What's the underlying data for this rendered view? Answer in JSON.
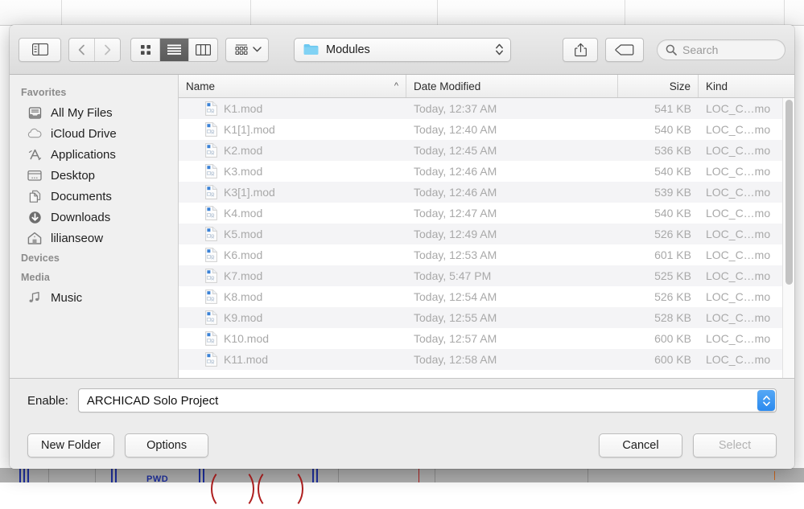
{
  "toolbar": {
    "sidebar_toggle": "sidebar-toggle",
    "back": "back",
    "forward": "forward",
    "view_icon": "icon-view",
    "view_list": "list-view",
    "view_column": "column-view",
    "arrange": "arrange",
    "path_label": "Modules",
    "share": "share",
    "tag": "tag",
    "search_placeholder": "Search",
    "search_value": ""
  },
  "sidebar": {
    "sections": [
      {
        "title": "Favorites",
        "items": [
          {
            "label": "All My Files",
            "icon": "all-my-files-icon"
          },
          {
            "label": "iCloud Drive",
            "icon": "icloud-drive-icon"
          },
          {
            "label": "Applications",
            "icon": "applications-icon"
          },
          {
            "label": "Desktop",
            "icon": "desktop-icon"
          },
          {
            "label": "Documents",
            "icon": "documents-icon"
          },
          {
            "label": "Downloads",
            "icon": "downloads-icon"
          },
          {
            "label": "lilianseow",
            "icon": "home-icon"
          }
        ]
      },
      {
        "title": "Devices",
        "items": []
      },
      {
        "title": "Media",
        "items": [
          {
            "label": "Music",
            "icon": "music-icon"
          }
        ]
      }
    ]
  },
  "filelist": {
    "columns": [
      {
        "key": "name",
        "label": "Name",
        "sort": "ascending"
      },
      {
        "key": "date",
        "label": "Date Modified"
      },
      {
        "key": "size",
        "label": "Size"
      },
      {
        "key": "kind",
        "label": "Kind"
      }
    ],
    "rows": [
      {
        "name": "K1.mod",
        "date": "Today, 12:37 AM",
        "size": "541 KB",
        "kind": "LOC_C…mo"
      },
      {
        "name": "K1[1].mod",
        "date": "Today, 12:40 AM",
        "size": "540 KB",
        "kind": "LOC_C…mo"
      },
      {
        "name": "K2.mod",
        "date": "Today, 12:45 AM",
        "size": "536 KB",
        "kind": "LOC_C…mo"
      },
      {
        "name": "K3.mod",
        "date": "Today, 12:46 AM",
        "size": "540 KB",
        "kind": "LOC_C…mo"
      },
      {
        "name": "K3[1].mod",
        "date": "Today, 12:46 AM",
        "size": "539 KB",
        "kind": "LOC_C…mo"
      },
      {
        "name": "K4.mod",
        "date": "Today, 12:47 AM",
        "size": "540 KB",
        "kind": "LOC_C…mo"
      },
      {
        "name": "K5.mod",
        "date": "Today, 12:49 AM",
        "size": "526 KB",
        "kind": "LOC_C…mo"
      },
      {
        "name": "K6.mod",
        "date": "Today, 12:53 AM",
        "size": "601 KB",
        "kind": "LOC_C…mo"
      },
      {
        "name": "K7.mod",
        "date": "Today, 5:47 PM",
        "size": "525 KB",
        "kind": "LOC_C…mo"
      },
      {
        "name": "K8.mod",
        "date": "Today, 12:54 AM",
        "size": "526 KB",
        "kind": "LOC_C…mo"
      },
      {
        "name": "K9.mod",
        "date": "Today, 12:55 AM",
        "size": "528 KB",
        "kind": "LOC_C…mo"
      },
      {
        "name": "K10.mod",
        "date": "Today, 12:57 AM",
        "size": "600 KB",
        "kind": "LOC_C…mo"
      },
      {
        "name": "K11.mod",
        "date": "Today, 12:58 AM",
        "size": "600 KB",
        "kind": "LOC_C…mo"
      }
    ]
  },
  "enable": {
    "label": "Enable:",
    "value": "ARCHICAD Solo Project"
  },
  "buttons": {
    "new_folder": "New Folder",
    "options": "Options",
    "cancel": "Cancel",
    "select": "Select"
  },
  "background": {
    "cad_label": "PWD"
  },
  "colors": {
    "accent_blue": "#2b8aef",
    "folder_blue": "#6cc8f0",
    "disabled_text": "#a9a9a9",
    "cad_wall": "#1e2f9e",
    "cad_arc": "#b02020"
  }
}
